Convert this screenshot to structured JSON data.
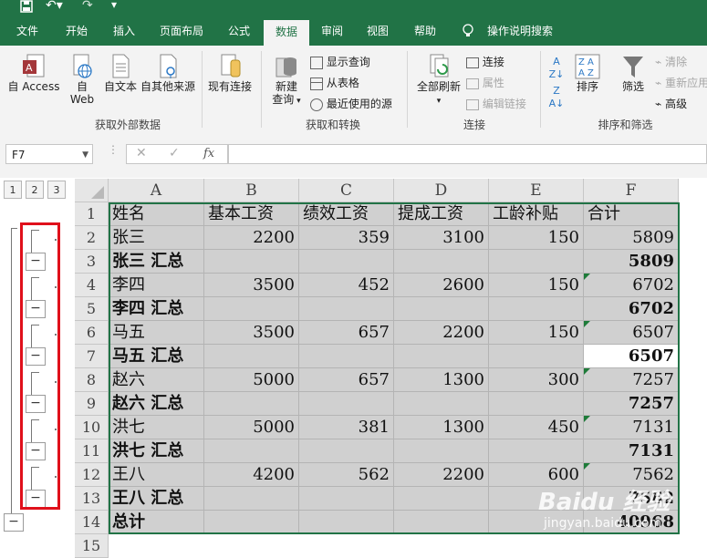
{
  "ribbon_tabs": [
    "文件",
    "开始",
    "插入",
    "页面布局",
    "公式",
    "数据",
    "审阅",
    "视图",
    "帮助",
    "操作说明搜索"
  ],
  "active_tab": "数据",
  "ribbon": {
    "get_external": {
      "access": "自 Access",
      "web_line1": "自",
      "web_line2": "Web",
      "text": "自文本",
      "other": "自其他来源",
      "existing": "现有连接",
      "group_label": "获取外部数据"
    },
    "transform": {
      "new_query_line1": "新建",
      "new_query_line2": "查询",
      "show_queries": "显示查询",
      "from_table": "从表格",
      "recent_sources": "最近使用的源",
      "group_label": "获取和转换"
    },
    "connections": {
      "refresh_all": "全部刷新",
      "connections": "连接",
      "properties": "属性",
      "edit_links": "编辑链接",
      "group_label": "连接"
    },
    "sort_filter": {
      "sort": "排序",
      "filter": "筛选",
      "clear": "清除",
      "reapply": "重新应用",
      "advanced": "高级",
      "group_label": "排序和筛选"
    }
  },
  "formula_bar": {
    "name_box": "F7",
    "fx": "fx",
    "value": ""
  },
  "outline_levels": [
    "1",
    "2",
    "3"
  ],
  "outline_collapse_symbol": "−",
  "columns": [
    "A",
    "B",
    "C",
    "D",
    "E",
    "F"
  ],
  "rows": [
    {
      "n": "1",
      "cells": [
        "姓名",
        "基本工资",
        "绩效工资",
        "提成工资",
        "工龄补贴",
        "合计"
      ],
      "bold": false,
      "header": true
    },
    {
      "n": "2",
      "cells": [
        "张三",
        "2200",
        "359",
        "3100",
        "150",
        "5809"
      ],
      "bold": false
    },
    {
      "n": "3",
      "cells": [
        "张三 汇总",
        "",
        "",
        "",
        "",
        "5809"
      ],
      "bold": true
    },
    {
      "n": "4",
      "cells": [
        "李四",
        "3500",
        "452",
        "2600",
        "150",
        "6702"
      ],
      "bold": false,
      "flag": true
    },
    {
      "n": "5",
      "cells": [
        "李四 汇总",
        "",
        "",
        "",
        "",
        "6702"
      ],
      "bold": true
    },
    {
      "n": "6",
      "cells": [
        "马五",
        "3500",
        "657",
        "2200",
        "150",
        "6507"
      ],
      "bold": false,
      "flag": true
    },
    {
      "n": "7",
      "cells": [
        "马五 汇总",
        "",
        "",
        "",
        "",
        "6507"
      ],
      "bold": true,
      "active": true
    },
    {
      "n": "8",
      "cells": [
        "赵六",
        "5000",
        "657",
        "1300",
        "300",
        "7257"
      ],
      "bold": false,
      "flag": true
    },
    {
      "n": "9",
      "cells": [
        "赵六 汇总",
        "",
        "",
        "",
        "",
        "7257"
      ],
      "bold": true
    },
    {
      "n": "10",
      "cells": [
        "洪七",
        "5000",
        "381",
        "1300",
        "450",
        "7131"
      ],
      "bold": false,
      "flag": true
    },
    {
      "n": "11",
      "cells": [
        "洪七 汇总",
        "",
        "",
        "",
        "",
        "7131"
      ],
      "bold": true
    },
    {
      "n": "12",
      "cells": [
        "王八",
        "4200",
        "562",
        "2200",
        "600",
        "7562"
      ],
      "bold": false,
      "flag": true
    },
    {
      "n": "13",
      "cells": [
        "王八 汇总",
        "",
        "",
        "",
        "",
        "7562"
      ],
      "bold": true
    },
    {
      "n": "14",
      "cells": [
        "总计",
        "",
        "",
        "",
        "",
        "40968"
      ],
      "bold": true
    },
    {
      "n": "15",
      "cells": [
        "",
        "",
        "",
        "",
        "",
        ""
      ],
      "bold": false
    }
  ],
  "watermark": {
    "main": "Baidu 经验",
    "sub": "jingyan.baidu.com"
  },
  "colors": {
    "excel_green": "#217346",
    "highlight_red": "#e0101b",
    "selected_fill": "#d0d0d0"
  }
}
